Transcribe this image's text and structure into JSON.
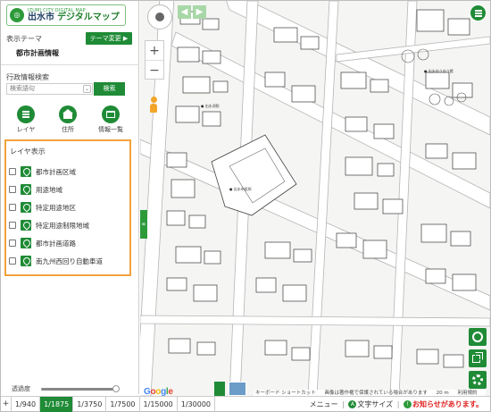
{
  "header": {
    "logo_small": "IZUMI CITY DIGITAL MAP",
    "logo_city": "出水市",
    "logo_title": "デジタルマップ"
  },
  "theme": {
    "label": "表示テーマ",
    "change_button": "テーマ変更 ▶",
    "value": "都市計画情報"
  },
  "search": {
    "label": "行政情報検索",
    "placeholder": "検索語句",
    "button": "検索"
  },
  "nav": [
    {
      "label": "レイヤ",
      "icon": "list-icon"
    },
    {
      "label": "住所",
      "icon": "home-icon"
    },
    {
      "label": "情報一覧",
      "icon": "table-icon"
    }
  ],
  "layers": {
    "title": "レイヤ表示",
    "items": [
      {
        "label": "都市計画区域",
        "checked": false
      },
      {
        "label": "用途地域",
        "checked": false
      },
      {
        "label": "特定用途地区",
        "checked": false
      },
      {
        "label": "特定用途制限地域",
        "checked": false
      },
      {
        "label": "都市計画道路",
        "checked": false
      },
      {
        "label": "南九州西回り自動車道",
        "checked": false
      }
    ]
  },
  "opacity": {
    "label": "透過度",
    "value": 0.95
  },
  "scales": {
    "plus": "+",
    "items": [
      "1/940",
      "1/1875",
      "1/3750",
      "1/7500",
      "1/15000",
      "1/30000"
    ],
    "active_index": 1
  },
  "footer": {
    "menu": "メニュー",
    "text_size": "文字サイズ",
    "notice": "お知らせがあります。",
    "text_size_icon": "A",
    "notice_icon": "!"
  },
  "map": {
    "zoom_in": "+",
    "zoom_out": "−",
    "back": "◀",
    "forward": "▶",
    "collapse": "«",
    "google": [
      "G",
      "o",
      "o",
      "g",
      "l",
      "e"
    ],
    "attribution": [
      "キーボード ショートカット",
      "画像は著作権で保護されている場合があります",
      "20 m",
      "利用規約"
    ]
  },
  "colors": {
    "brand_green": "#1f8b36",
    "highlight_orange": "#f2a23c",
    "notice_red": "#e02020"
  }
}
